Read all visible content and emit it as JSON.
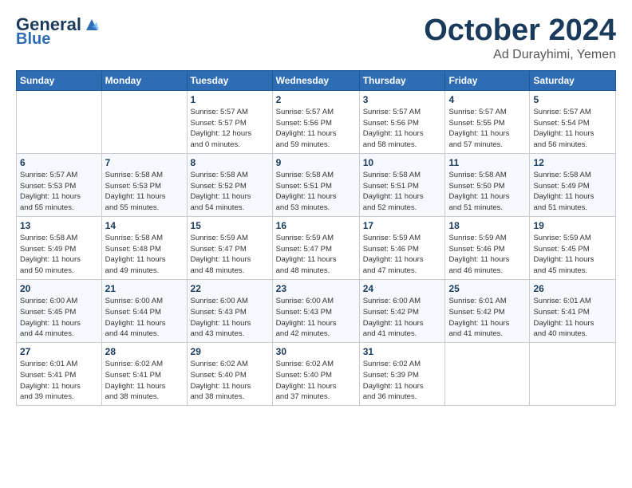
{
  "logo": {
    "line1": "General",
    "line2": "Blue",
    "tagline": ""
  },
  "title": "October 2024",
  "subtitle": "Ad Durayhimi, Yemen",
  "days_of_week": [
    "Sunday",
    "Monday",
    "Tuesday",
    "Wednesday",
    "Thursday",
    "Friday",
    "Saturday"
  ],
  "weeks": [
    [
      {
        "day": "",
        "detail": ""
      },
      {
        "day": "",
        "detail": ""
      },
      {
        "day": "1",
        "detail": "Sunrise: 5:57 AM\nSunset: 5:57 PM\nDaylight: 12 hours\nand 0 minutes."
      },
      {
        "day": "2",
        "detail": "Sunrise: 5:57 AM\nSunset: 5:56 PM\nDaylight: 11 hours\nand 59 minutes."
      },
      {
        "day": "3",
        "detail": "Sunrise: 5:57 AM\nSunset: 5:56 PM\nDaylight: 11 hours\nand 58 minutes."
      },
      {
        "day": "4",
        "detail": "Sunrise: 5:57 AM\nSunset: 5:55 PM\nDaylight: 11 hours\nand 57 minutes."
      },
      {
        "day": "5",
        "detail": "Sunrise: 5:57 AM\nSunset: 5:54 PM\nDaylight: 11 hours\nand 56 minutes."
      }
    ],
    [
      {
        "day": "6",
        "detail": "Sunrise: 5:57 AM\nSunset: 5:53 PM\nDaylight: 11 hours\nand 55 minutes."
      },
      {
        "day": "7",
        "detail": "Sunrise: 5:58 AM\nSunset: 5:53 PM\nDaylight: 11 hours\nand 55 minutes."
      },
      {
        "day": "8",
        "detail": "Sunrise: 5:58 AM\nSunset: 5:52 PM\nDaylight: 11 hours\nand 54 minutes."
      },
      {
        "day": "9",
        "detail": "Sunrise: 5:58 AM\nSunset: 5:51 PM\nDaylight: 11 hours\nand 53 minutes."
      },
      {
        "day": "10",
        "detail": "Sunrise: 5:58 AM\nSunset: 5:51 PM\nDaylight: 11 hours\nand 52 minutes."
      },
      {
        "day": "11",
        "detail": "Sunrise: 5:58 AM\nSunset: 5:50 PM\nDaylight: 11 hours\nand 51 minutes."
      },
      {
        "day": "12",
        "detail": "Sunrise: 5:58 AM\nSunset: 5:49 PM\nDaylight: 11 hours\nand 51 minutes."
      }
    ],
    [
      {
        "day": "13",
        "detail": "Sunrise: 5:58 AM\nSunset: 5:49 PM\nDaylight: 11 hours\nand 50 minutes."
      },
      {
        "day": "14",
        "detail": "Sunrise: 5:58 AM\nSunset: 5:48 PM\nDaylight: 11 hours\nand 49 minutes."
      },
      {
        "day": "15",
        "detail": "Sunrise: 5:59 AM\nSunset: 5:47 PM\nDaylight: 11 hours\nand 48 minutes."
      },
      {
        "day": "16",
        "detail": "Sunrise: 5:59 AM\nSunset: 5:47 PM\nDaylight: 11 hours\nand 48 minutes."
      },
      {
        "day": "17",
        "detail": "Sunrise: 5:59 AM\nSunset: 5:46 PM\nDaylight: 11 hours\nand 47 minutes."
      },
      {
        "day": "18",
        "detail": "Sunrise: 5:59 AM\nSunset: 5:46 PM\nDaylight: 11 hours\nand 46 minutes."
      },
      {
        "day": "19",
        "detail": "Sunrise: 5:59 AM\nSunset: 5:45 PM\nDaylight: 11 hours\nand 45 minutes."
      }
    ],
    [
      {
        "day": "20",
        "detail": "Sunrise: 6:00 AM\nSunset: 5:45 PM\nDaylight: 11 hours\nand 44 minutes."
      },
      {
        "day": "21",
        "detail": "Sunrise: 6:00 AM\nSunset: 5:44 PM\nDaylight: 11 hours\nand 44 minutes."
      },
      {
        "day": "22",
        "detail": "Sunrise: 6:00 AM\nSunset: 5:43 PM\nDaylight: 11 hours\nand 43 minutes."
      },
      {
        "day": "23",
        "detail": "Sunrise: 6:00 AM\nSunset: 5:43 PM\nDaylight: 11 hours\nand 42 minutes."
      },
      {
        "day": "24",
        "detail": "Sunrise: 6:00 AM\nSunset: 5:42 PM\nDaylight: 11 hours\nand 41 minutes."
      },
      {
        "day": "25",
        "detail": "Sunrise: 6:01 AM\nSunset: 5:42 PM\nDaylight: 11 hours\nand 41 minutes."
      },
      {
        "day": "26",
        "detail": "Sunrise: 6:01 AM\nSunset: 5:41 PM\nDaylight: 11 hours\nand 40 minutes."
      }
    ],
    [
      {
        "day": "27",
        "detail": "Sunrise: 6:01 AM\nSunset: 5:41 PM\nDaylight: 11 hours\nand 39 minutes."
      },
      {
        "day": "28",
        "detail": "Sunrise: 6:02 AM\nSunset: 5:41 PM\nDaylight: 11 hours\nand 38 minutes."
      },
      {
        "day": "29",
        "detail": "Sunrise: 6:02 AM\nSunset: 5:40 PM\nDaylight: 11 hours\nand 38 minutes."
      },
      {
        "day": "30",
        "detail": "Sunrise: 6:02 AM\nSunset: 5:40 PM\nDaylight: 11 hours\nand 37 minutes."
      },
      {
        "day": "31",
        "detail": "Sunrise: 6:02 AM\nSunset: 5:39 PM\nDaylight: 11 hours\nand 36 minutes."
      },
      {
        "day": "",
        "detail": ""
      },
      {
        "day": "",
        "detail": ""
      }
    ]
  ]
}
